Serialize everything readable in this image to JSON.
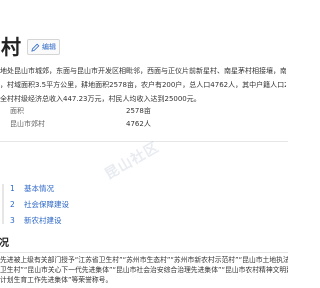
{
  "page": {
    "title": "村",
    "edit_label": "编辑"
  },
  "intro": [
    "地处昆山市城郊，东面与昆山市开发区相毗邻，西面与正仪片前新星村、南星茅村相接壤，南至",
    "，村域面积3.5平方公里，耕地面积2578亩，农户有200户，总人口4762人，其中户籍人口2062",
    "全村村级经济总收入447.23万元，村民人均收入达到25000元。"
  ],
  "infobox": [
    {
      "key": "面积",
      "value": "2578亩"
    },
    {
      "key": "昆山市郊村",
      "value": "4762人"
    }
  ],
  "toc": [
    {
      "num": "1",
      "label": "基本情况"
    },
    {
      "num": "2",
      "label": "社会保障建设"
    },
    {
      "num": "3",
      "label": "新农村建设"
    }
  ],
  "section": {
    "title": "况",
    "body": [
      "先进被上级有关部门授予“江苏省卫生村”“苏州市生态村”“苏州市新农村示范村”“昆山市土地执法示范",
      "卫生村”“昆山市关心下一代先进集体”“昆山市社会治安综合治理先进集体”“昆山市农村精神文明建设",
      "计划生育工作先进集体”等荣誉称号。"
    ]
  },
  "watermark": {
    "text": "昆山社区"
  },
  "colors": {
    "link": "#2c67c8",
    "text": "#333333",
    "muted": "#666666",
    "rule": "#e6e6e6"
  },
  "icons": {
    "edit": "pencil-icon"
  }
}
